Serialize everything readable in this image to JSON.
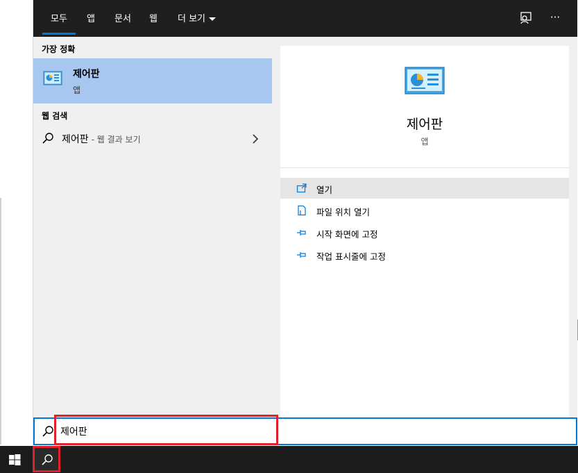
{
  "tabs": [
    {
      "label": "모두",
      "active": true
    },
    {
      "label": "앱"
    },
    {
      "label": "문서"
    },
    {
      "label": "웹"
    },
    {
      "label": "더 보기"
    }
  ],
  "top_icons": {
    "feedback": "feedback-icon",
    "more": "···"
  },
  "best_match": {
    "heading": "가장 정확",
    "name": "제어판",
    "type": "앱",
    "icon": "control-panel-icon"
  },
  "web_search": {
    "heading": "웹 검색",
    "term": "제어판",
    "hint": "- 웹 결과 보기"
  },
  "detail": {
    "title": "제어판",
    "subtitle": "앱",
    "actions": [
      {
        "label": "열기",
        "icon": "open-icon"
      },
      {
        "label": "파일 위치 열기",
        "icon": "file-location-icon"
      },
      {
        "label": "시작 화면에 고정",
        "icon": "pin-icon"
      },
      {
        "label": "작업 표시줄에 고정",
        "icon": "pin-icon"
      }
    ]
  },
  "search": {
    "value": "제어판"
  },
  "colors": {
    "accent": "#0078d7",
    "highlight": "#e0202a",
    "selected_row": "#a8c7f0"
  }
}
